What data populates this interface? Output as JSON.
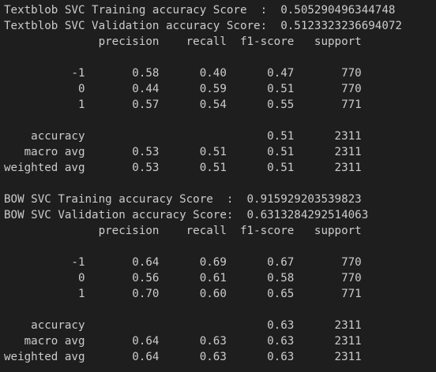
{
  "terminal": {
    "lines": [
      "Textblob SVC Training accuracy Score  :  0.505290496344748",
      "Textblob SVC Validation accuracy Score:  0.5123323236694072",
      "              precision    recall  f1-score   support",
      "",
      "          -1       0.58      0.40      0.47       770",
      "           0       0.44      0.59      0.51       770",
      "           1       0.57      0.54      0.55       771",
      "",
      "    accuracy                           0.51      2311",
      "   macro avg       0.53      0.51      0.51      2311",
      "weighted avg       0.53      0.51      0.51      2311",
      "",
      "BOW SVC Training accuracy Score  :  0.915929203539823",
      "BOW SVC Validation accuracy Score:  0.6313284292514063",
      "              precision    recall  f1-score   support",
      "",
      "          -1       0.64      0.69      0.67       770",
      "           0       0.56      0.61      0.58       770",
      "           1       0.70      0.60      0.65       771",
      "",
      "    accuracy                           0.63      2311",
      "   macro avg       0.64      0.63      0.63      2311",
      "weighted avg       0.64      0.63      0.63      2311"
    ]
  },
  "colors": {
    "background": "#1e1e1e",
    "text": "#cccccc"
  }
}
